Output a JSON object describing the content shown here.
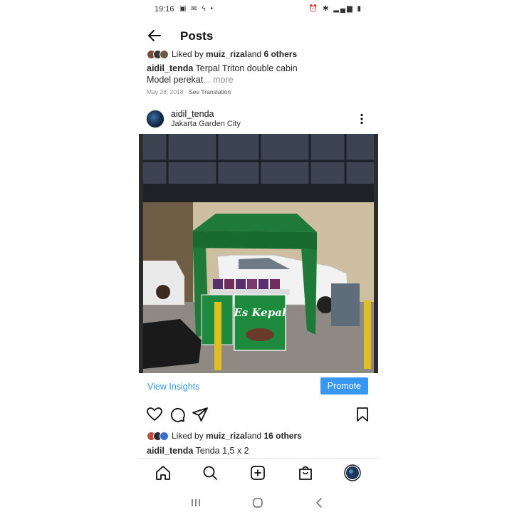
{
  "status_bar": {
    "time": "19:16",
    "left_icons": "▣ ✉ ϟ •",
    "right_icons": "⏰ ✱ ▂▄▆ ▮"
  },
  "app_bar": {
    "title": "Posts"
  },
  "previous_post": {
    "liked_by_prefix": "Liked by ",
    "liked_by_user": "muiz_rizal",
    "liked_by_suffix": " and ",
    "liked_by_others": "6 others",
    "caption_user": "aidil_tenda",
    "caption_text": " Terpal Triton double cabin",
    "caption_line2": "Model perekat",
    "more_label": "... more",
    "date": "May 28, 2018",
    "translation_link": "See Translation"
  },
  "post": {
    "username": "aidil_tenda",
    "location": "Jakarta Garden City",
    "photo_sign": "Es Kepal",
    "view_insights_label": "View Insights",
    "promote_label": "Promote",
    "liked_by_prefix": "Liked by ",
    "liked_by_user": "muiz_rizal",
    "liked_by_suffix": " and ",
    "liked_by_others": "16 others",
    "caption_user": "aidil_tenda",
    "caption_text": " Tenda 1,5 x 2"
  },
  "colors": {
    "accent": "#3897f0",
    "tent_green": "#1f7a3a",
    "text": "#262626",
    "muted": "#8e8e8e"
  },
  "icons": {
    "back": "arrow-left-icon",
    "kebab": "more-vertical-icon",
    "like": "heart-icon",
    "comment": "comment-icon",
    "share": "send-icon",
    "save": "bookmark-icon",
    "home": "home-icon",
    "search": "search-icon",
    "new_post": "plus-square-icon",
    "shop": "shopping-bag-icon",
    "profile": "profile-avatar-icon"
  }
}
